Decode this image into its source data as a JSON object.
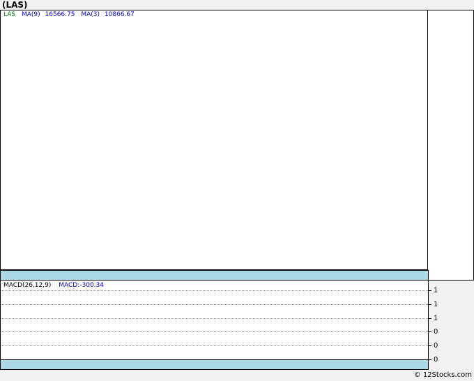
{
  "title": "(LAS)",
  "legend": {
    "ticker": "LAS",
    "ma9_label": "MA(9)",
    "ma9_value": "16566.75",
    "ma3_label": "MA(3)",
    "ma3_value": "10866.67"
  },
  "macd": {
    "label": "MACD(26,12,9)",
    "value": "MACD:-300.34"
  },
  "chart_data": {
    "type": "line",
    "title": "(LAS)",
    "xlabel": "",
    "ylabel": "",
    "grid": true,
    "series": [],
    "macd_ticks": [
      "1",
      "1",
      "1",
      "0",
      "0",
      "0"
    ]
  },
  "credit": "© 12Stocks.com",
  "colors": {
    "ticker": "#008000",
    "ma": "#0000cc",
    "band": "#add8e6",
    "grid": "#999999"
  }
}
